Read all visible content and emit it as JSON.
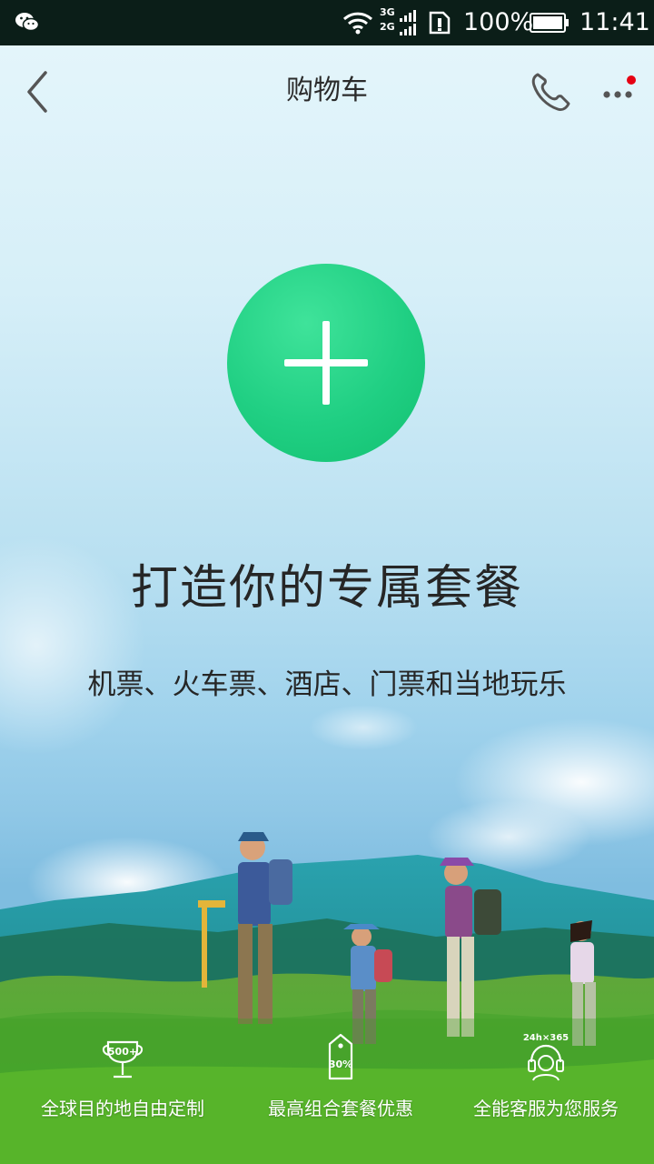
{
  "status_bar": {
    "signal_top": "3G",
    "signal_bottom": "2G",
    "battery": "100%",
    "time": "11:41"
  },
  "nav": {
    "title": "购物车"
  },
  "hero": {
    "headline": "打造你的专属套餐",
    "subline": "机票、火车票、酒店、门票和当地玩乐"
  },
  "features": [
    {
      "icon": "trophy-icon",
      "badge": "500+",
      "label": "全球目的地自由定制"
    },
    {
      "icon": "discount-tag-icon",
      "badge": "30%",
      "label": "最高组合套餐优惠"
    },
    {
      "icon": "customer-service-icon",
      "badge": "24h×365",
      "label": "全能客服为您服务"
    }
  ],
  "colors": {
    "status_bar": "#0b1e18",
    "accent_green": "#20cf83",
    "notification_dot": "#e60012"
  }
}
